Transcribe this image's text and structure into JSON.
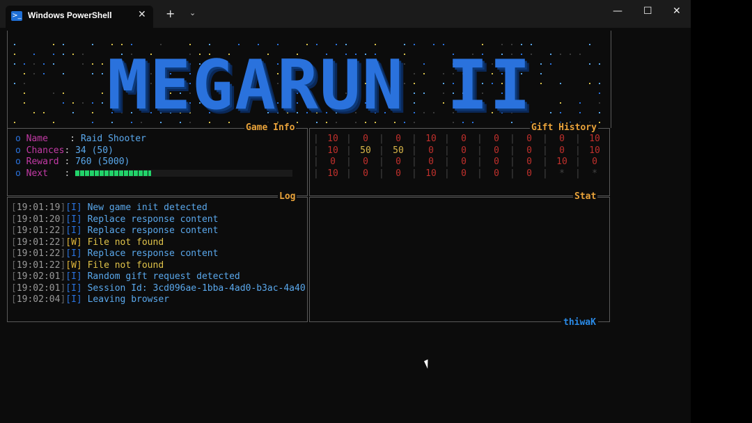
{
  "window": {
    "tab_title": "Windows PowerShell",
    "tab_icon_glyph": ">_",
    "close_tab": "✕",
    "new_tab": "+",
    "dropdown": "⌄",
    "minimize": "—",
    "maximize": "☐",
    "close": "✕"
  },
  "banner": {
    "text": "MEGARUN II"
  },
  "game_info": {
    "title": "Game Info",
    "bullet": "o",
    "rows": [
      {
        "label": "Name    ",
        "sep": ": ",
        "value": "Raid Shooter"
      },
      {
        "label": "Chances",
        "sep": ": ",
        "value": "34 (50)"
      },
      {
        "label": "Reward ",
        "sep": ": ",
        "value": "760 (5000)"
      },
      {
        "label": "Next   ",
        "sep": ": ",
        "value": ""
      }
    ],
    "next_progress": 0.35
  },
  "gift_history": {
    "title": "Gift History",
    "rows": [
      [
        "10",
        "0",
        "0",
        "10",
        "0",
        "0",
        "0",
        "0",
        "10"
      ],
      [
        "10",
        "50",
        "50",
        "0",
        "0",
        "0",
        "0",
        "0",
        "10"
      ],
      [
        "0",
        "0",
        "0",
        "0",
        "0",
        "0",
        "0",
        "10",
        "0"
      ],
      [
        "10",
        "0",
        "0",
        "10",
        "0",
        "0",
        "0",
        "*",
        "*"
      ]
    ]
  },
  "log": {
    "title": "Log",
    "entries": [
      {
        "time": "19:01:19",
        "level": "I",
        "message": "New game init detected"
      },
      {
        "time": "19:01:20",
        "level": "I",
        "message": "Replace response content"
      },
      {
        "time": "19:01:22",
        "level": "I",
        "message": "Replace response content"
      },
      {
        "time": "19:01:22",
        "level": "W",
        "message": "File not found"
      },
      {
        "time": "19:01:22",
        "level": "I",
        "message": "Replace response content"
      },
      {
        "time": "19:01:22",
        "level": "W",
        "message": "File not found"
      },
      {
        "time": "19:02:01",
        "level": "I",
        "message": "Random gift request detected"
      },
      {
        "time": "19:02:01",
        "level": "I",
        "message": "Session Id: 3cd096ae-1bba-4ad0-b3ac-4a40"
      },
      {
        "time": "19:02:04",
        "level": "I",
        "message": "Leaving browser"
      }
    ]
  },
  "stat": {
    "title": "Stat"
  },
  "footer": {
    "author": "thiwaK"
  },
  "colors": {
    "accent_blue": "#2a72dd",
    "title_orange": "#e8a23a",
    "label_magenta": "#c33aa6",
    "value_blue": "#5aa8ec",
    "gift_red": "#c0302c",
    "gift_yellow": "#d9b74a",
    "progress_green": "#22d36a"
  }
}
